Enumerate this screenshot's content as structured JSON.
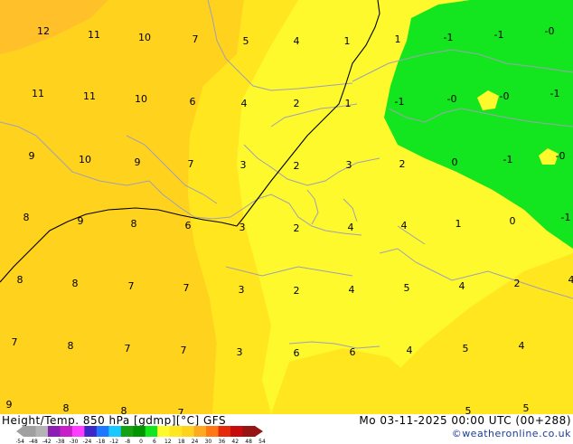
{
  "footer": {
    "title_left": "Height/Temp. 850 hPa [gdmp][°C] GFS",
    "title_right": "Mo 03-11-2025 00:00 UTC (00+288)",
    "credit": "©weatheronline.co.uk"
  },
  "colors": {
    "light_yellow": "#fdf92d",
    "yellow": "#ffe61e",
    "orange_yellow": "#ffd21e",
    "orange": "#ffc02a",
    "green": "#13e61e",
    "coast": "#a0a0b4"
  },
  "scale": {
    "labels": [
      "-54",
      "-48",
      "-42",
      "-38",
      "-30",
      "-24",
      "-18",
      "-12",
      "-8",
      "0",
      "6",
      "12",
      "18",
      "24",
      "30",
      "36",
      "42",
      "48",
      "54"
    ],
    "colors": [
      "#a0a0a0",
      "#b4b4b4",
      "#8c1eb4",
      "#c81ec8",
      "#ff3cff",
      "#3c28c8",
      "#1e78ff",
      "#19c8ff",
      "#16a014",
      "#009600",
      "#13e61e",
      "#fdf92d",
      "#ffe61e",
      "#ffd21e",
      "#ffaa1e",
      "#ff7814",
      "#e6280a",
      "#c80a0a",
      "#961414"
    ]
  },
  "values": {
    "t1": "12",
    "t2": "11",
    "t3": "10",
    "t4": "7",
    "t5": "5",
    "t6": "4",
    "t7": "1",
    "t8": "1",
    "t9": "-1",
    "t10": "-1",
    "t11": "-0",
    "t12": "11",
    "t13": "11",
    "t14": "10",
    "t15": "6",
    "t16": "4",
    "t17": "2",
    "t18": "1",
    "t19": "-1",
    "t20": "-0",
    "t21": "-0",
    "t22": "-1",
    "t23": "9",
    "t24": "10",
    "t25": "9",
    "t26": "7",
    "t27": "3",
    "t28": "2",
    "t29": "3",
    "t30": "2",
    "t31": "0",
    "t32": "-1",
    "t33": "-0",
    "t34": "8",
    "t35": "9",
    "t36": "8",
    "t37": "6",
    "t38": "3",
    "t39": "2",
    "t40": "4",
    "t41": "4",
    "t42": "1",
    "t43": "0",
    "t44": "-1",
    "t45": "8",
    "t46": "8",
    "t47": "7",
    "t48": "7",
    "t49": "3",
    "t50": "2",
    "t51": "4",
    "t52": "5",
    "t53": "4",
    "t54": "2",
    "t55": "4",
    "t56": "7",
    "t57": "8",
    "t58": "7",
    "t59": "7",
    "t60": "3",
    "t61": "6",
    "t62": "6",
    "t63": "4",
    "t64": "5",
    "t65": "4",
    "t66": "9",
    "t67": "8",
    "t68": "8",
    "t69": "7",
    "t70": "5",
    "t71": "5"
  }
}
